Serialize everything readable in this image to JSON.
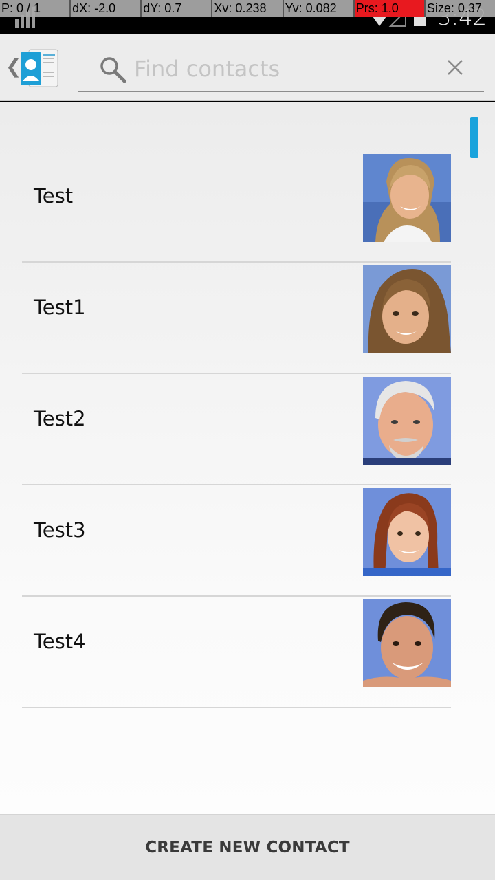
{
  "status_bar": {
    "time": "3:42"
  },
  "debug_overlay": {
    "pointer": "P: 0 / 1",
    "dx": "dX: -2.0",
    "dy": "dY: 0.7",
    "xv": "Xv: 0.238",
    "yv": "Yv: 0.082",
    "pressure": "Prs: 1.0",
    "size": "Size: 0.37",
    "highlight_color": "#e8191f"
  },
  "app_bar": {
    "up_icon": "chevron-left-icon",
    "app_icon": "contacts-app-icon",
    "search": {
      "placeholder": "Find contacts",
      "value": "",
      "search_icon": "search-icon",
      "clear_icon": "close-icon"
    }
  },
  "contacts": [
    {
      "name": "Test",
      "photo": "woman-blonde-smiling"
    },
    {
      "name": "Test1",
      "photo": "girl-brown-hair"
    },
    {
      "name": "Test2",
      "photo": "man-gray-beard"
    },
    {
      "name": "Test3",
      "photo": "woman-auburn-hair"
    },
    {
      "name": "Test4",
      "photo": "man-dark-hair-smiling"
    }
  ],
  "bottom_bar": {
    "create_label": "CREATE NEW CONTACT"
  },
  "colors": {
    "accent": "#1aa3dc",
    "app_bar_bg": "#ececec",
    "bottom_bar_bg": "#e4e4e4"
  }
}
